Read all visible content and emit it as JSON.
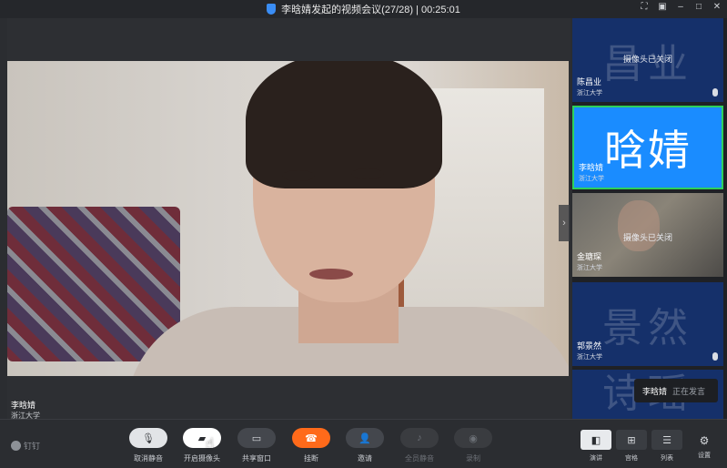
{
  "window": {
    "title": "李晗婧发起的视频会议(27/28) | 00:25:01"
  },
  "main_video": {
    "name": "李晗婧",
    "org": "浙江大学"
  },
  "participants": [
    {
      "big": "昌业",
      "note": "摄像头已关闭",
      "name": "陈昌业",
      "org": "浙江大学"
    },
    {
      "big": "晗婧",
      "note": "",
      "name": "李晗婧",
      "org": "浙江大学"
    },
    {
      "big": "",
      "note": "摄像头已关闭",
      "name": "金瑭琛",
      "org": "浙江大学"
    },
    {
      "big": "景然",
      "note": "",
      "name": "郭景然",
      "org": "浙江大学"
    },
    {
      "big": "诗瑶",
      "note": "",
      "name": "",
      "org": ""
    }
  ],
  "speaking": {
    "name": "李晗婧",
    "status": "正在发言"
  },
  "toolbar": {
    "brand": "钉钉",
    "mute": "取消静音",
    "camera": "开启摄像头",
    "share": "共享窗口",
    "hangup": "挂断",
    "invite": "邀请",
    "mute_all": "全员静音",
    "record": "录制",
    "view_speaker": "演讲",
    "view_grid": "宫格",
    "view_list": "列表",
    "settings": "设置"
  },
  "colors": {
    "active_tile": "#1a8cff",
    "active_border": "#2ed05a",
    "hangup": "#ff6a1a",
    "tile_bg": "#15306a"
  }
}
